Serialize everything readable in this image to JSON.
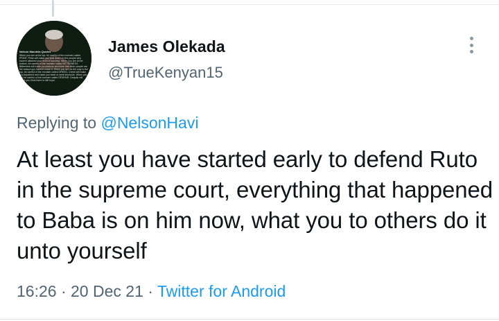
{
  "tweet": {
    "display_name": "James Olekada",
    "handle": "@TrueKenyan15",
    "replying_prefix": "Replying to ",
    "replying_to": "@NelsonHavi",
    "text": "At least you have started early to defend Ruto in the supreme court, everything that happened to Baba is on him now, what you to others do it unto yourself",
    "time": "16:26",
    "separator_1": " · ",
    "date": "20 Dec 21",
    "separator_2": " · ",
    "source": "Twitter for Android"
  },
  "avatar": {
    "caption_title": "Nelson Mandela Quotes",
    "caption_text": "When you are at the top, be careful of the monster called PRIDE. Pride will make you look down on the people who haven't attained your level of success. When you are at the bottom, be careful of the monster called BITTERNESS. Bitterness will make you jealous and think that other people are the reason you haven't made it. When you are on the way to the top, be careful of the monster called GREED. Greed will make you impatient and make you steal or seek shortcuts. When you fail, be careful of the monster called DESPAIR. Despair will make you think there is still hope."
  },
  "colors": {
    "accent": "#1d9bf0",
    "secondary_text": "#536471",
    "primary_text": "#0f1419"
  },
  "icons": {
    "more": "more-vertical-icon"
  }
}
